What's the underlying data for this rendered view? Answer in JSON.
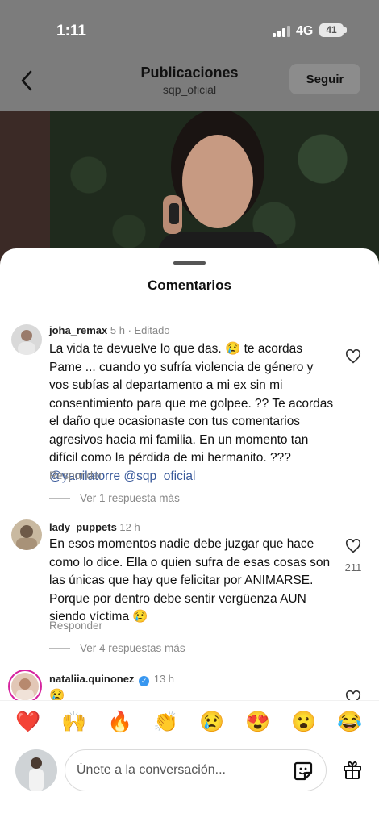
{
  "status": {
    "time": "1:11",
    "network": "4G",
    "battery": "41"
  },
  "header": {
    "title": "Publicaciones",
    "subtitle": "sqp_oficial",
    "follow_label": "Seguir"
  },
  "sheet": {
    "title": "Comentarios"
  },
  "comments": [
    {
      "username": "joha_remax",
      "meta": "5 h · Editado",
      "text": "La vida te devuelve lo que das. 😢 te acordas Pame ... cuando yo sufría violencia de género y vos subías al departamento a mi ex sin mi consentimiento para que me golpee. ?? Te acordas el daño que ocasionaste con tus comentarios agresivos hacia mi familia. En un momento tan difícil como la pérdida de mi hermanito. ???",
      "mentions": "@yanilatorre @sqp_oficial",
      "reply_label": "Responder",
      "more_replies": "Ver 1 respuesta más",
      "likes": ""
    },
    {
      "username": "lady_puppets",
      "meta": "12 h",
      "text": "En esos momentos nadie debe juzgar que hace como lo dice. Ella o quien sufra de esas cosas son las únicas que hay que felicitar por ANIMARSE. Porque por dentro debe sentir vergüenza AUN siendo víctima 😢",
      "reply_label": "Responder",
      "more_replies": "Ver 4 respuestas más",
      "likes": "211"
    },
    {
      "username": "nataliia.quinonez",
      "meta": "13 h",
      "text": "😢",
      "likes": ""
    }
  ],
  "reactions": [
    "❤️",
    "🙌",
    "🔥",
    "👏",
    "😢",
    "😍",
    "😮",
    "😂"
  ],
  "composer": {
    "placeholder": "Únete a la conversación..."
  },
  "icons": {
    "back": "chevron-left-icon",
    "heart": "heart-outline-icon",
    "sticker": "sticker-icon",
    "gift": "gift-icon",
    "verified": "verified-badge-icon"
  },
  "colors": {
    "mention": "#3a5a9b",
    "verified": "#3897f0",
    "follow_button": "#8c8c8c"
  }
}
